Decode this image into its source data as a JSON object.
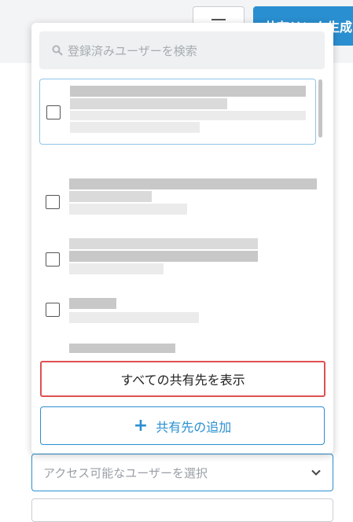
{
  "header": {
    "primary_button_label": "共有リンク生成",
    "menu_icon": "hamburger-icon"
  },
  "popup": {
    "search": {
      "placeholder": "登録済みユーザーを検索",
      "icon": "search-icon"
    },
    "user_list": {
      "items": [
        {
          "checked": false,
          "selected": true
        },
        {
          "checked": false,
          "selected": false
        },
        {
          "checked": false,
          "selected": false
        },
        {
          "checked": false,
          "selected": false
        },
        {
          "checked": false,
          "selected": false
        }
      ]
    },
    "show_all_label": "すべての共有先を表示",
    "add_label": "共有先の追加",
    "add_icon": "plus-icon"
  },
  "access_select": {
    "placeholder": "アクセス可能なユーザーを選択",
    "icon": "chevron-down-icon"
  },
  "colors": {
    "accent": "#2a8fd0",
    "highlight_border": "#e05050"
  }
}
